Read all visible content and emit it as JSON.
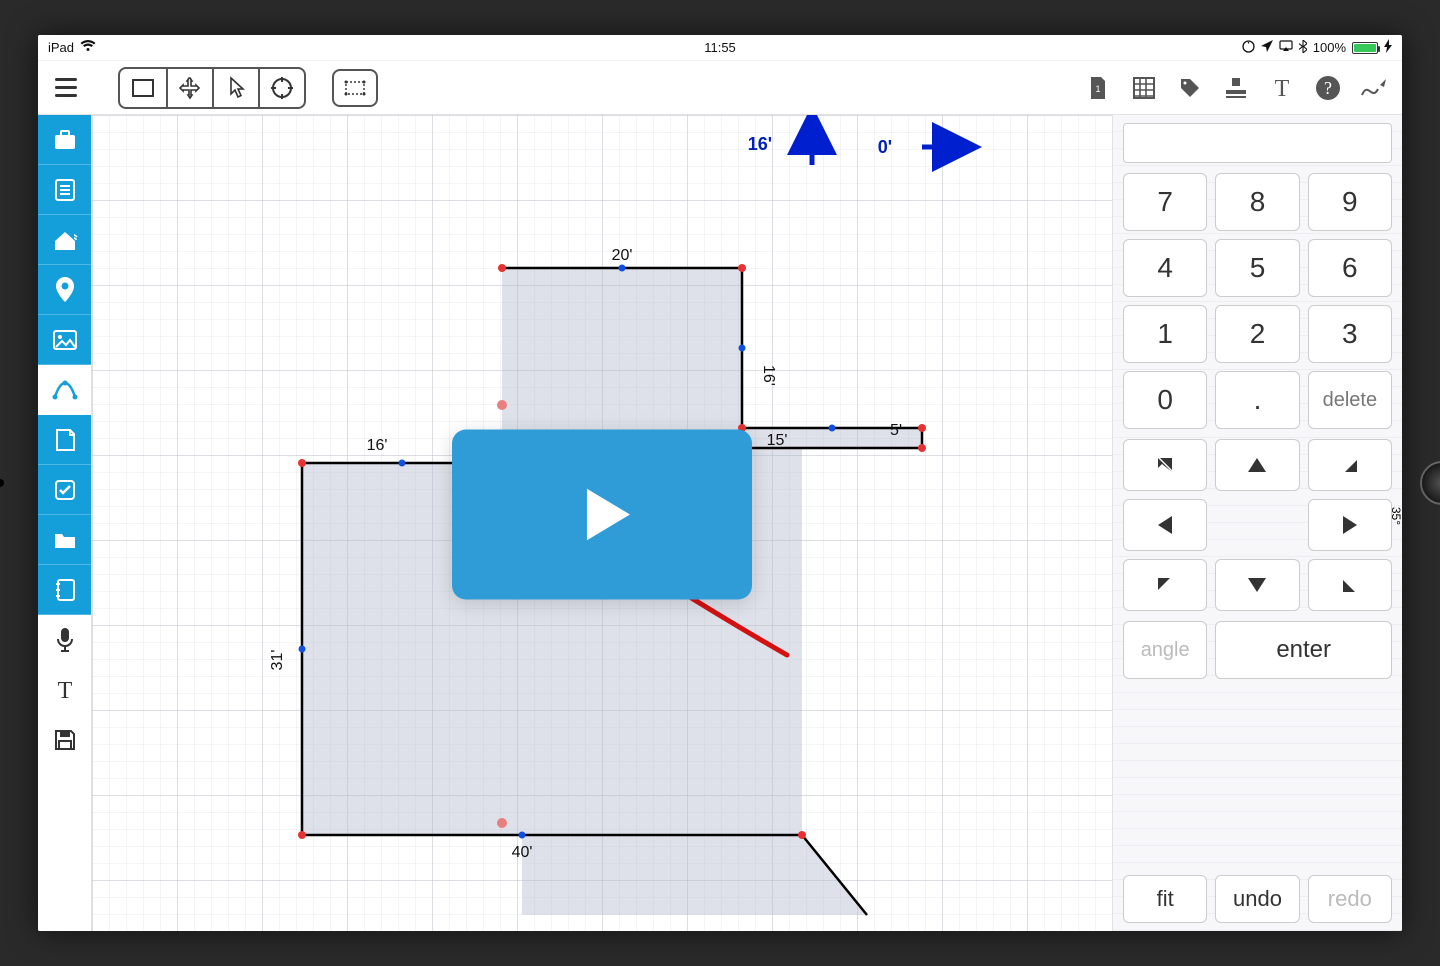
{
  "status": {
    "device": "iPad",
    "time": "11:55",
    "battery_text": "100%"
  },
  "offsets": {
    "up": "16'",
    "right": "0'"
  },
  "dimensions": {
    "top20": "20'",
    "right16": "16'",
    "right5": "5'",
    "mid15": "15'",
    "mid16": "16'",
    "left31": "31'",
    "bottom40": "40'"
  },
  "numpad": {
    "k7": "7",
    "k8": "8",
    "k9": "9",
    "k4": "4",
    "k5": "5",
    "k6": "6",
    "k1": "1",
    "k2": "2",
    "k3": "3",
    "k0": "0",
    "dot": ".",
    "delete": "delete",
    "angle": "angle",
    "enter": "enter",
    "fit": "fit",
    "undo": "undo",
    "redo": "redo",
    "angle35": "35°"
  }
}
